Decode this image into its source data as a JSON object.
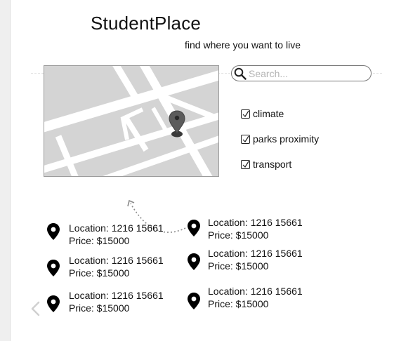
{
  "app": {
    "title": "StudentPlace",
    "tagline": "find where you want to live"
  },
  "search": {
    "placeholder": "Search...",
    "value": ""
  },
  "filters": [
    {
      "label": "climate",
      "checked": true
    },
    {
      "label": "parks proximity",
      "checked": true
    },
    {
      "label": "transport",
      "checked": true
    }
  ],
  "listings": [
    {
      "location": "Location: 1216 15661",
      "price": "Price: $15000"
    },
    {
      "location": "Location: 1216 15661",
      "price": "Price: $15000"
    },
    {
      "location": "Location: 1216 15661",
      "price": "Price: $15000"
    },
    {
      "location": "Location: 1216 15661",
      "price": "Price: $15000"
    },
    {
      "location": "Location: 1216 15661",
      "price": "Price: $15000"
    },
    {
      "location": "Location: 1216 15661",
      "price": "Price: $15000"
    }
  ],
  "icons": {
    "search": "search-icon",
    "pin": "map-pin-icon",
    "prev": "chevron-left-icon",
    "checkbox": "check-icon"
  },
  "colors": {
    "map_background": "#d4d4d4",
    "map_road": "#ffffff",
    "map_pin": "#555555"
  }
}
